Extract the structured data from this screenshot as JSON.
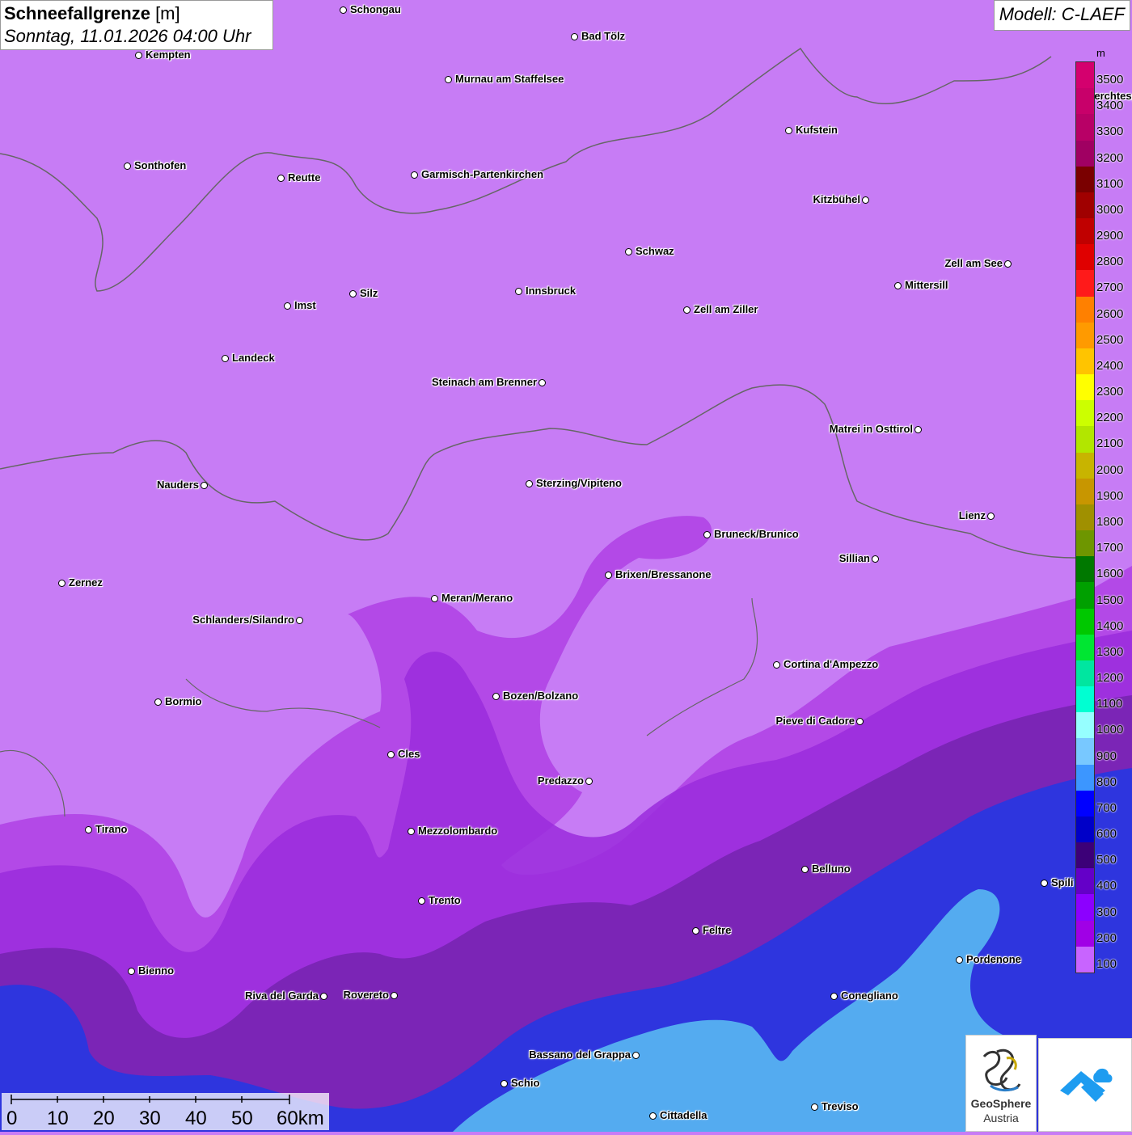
{
  "header": {
    "title_bold": "Schneefallgrenze",
    "title_unit": " [m]",
    "datetime": "Sonntag, 11.01.2026 04:00 Uhr",
    "model": "Modell: C-LAEF"
  },
  "legend": {
    "unit": "m",
    "levels": [
      "3500",
      "3400",
      "3300",
      "3200",
      "3100",
      "3000",
      "2900",
      "2800",
      "2700",
      "2600",
      "2500",
      "2400",
      "2300",
      "2200",
      "2100",
      "2000",
      "1900",
      "1800",
      "1700",
      "1600",
      "1500",
      "1400",
      "1300",
      "1200",
      "1100",
      "1000",
      "900",
      "800",
      "700",
      "600",
      "500",
      "400",
      "300",
      "200",
      "100"
    ],
    "colors": [
      "#d4006e",
      "#c8006a",
      "#b80066",
      "#a00062",
      "#7a0000",
      "#a00000",
      "#c00000",
      "#e00000",
      "#ff1a1a",
      "#ff8000",
      "#ff9a00",
      "#ffc400",
      "#ffff00",
      "#ccff00",
      "#b2e600",
      "#c8b400",
      "#c89600",
      "#a09000",
      "#6e9600",
      "#007800",
      "#00a000",
      "#00c800",
      "#00e632",
      "#00e6a0",
      "#00ffd2",
      "#96ffff",
      "#78c8ff",
      "#3c96ff",
      "#0000ff",
      "#0000c8",
      "#3c0078",
      "#6400c8",
      "#8c00ff",
      "#a000e6",
      "#c864ff"
    ]
  },
  "scale_bar": {
    "ticks": [
      "0",
      "10",
      "20",
      "30",
      "40",
      "50",
      "60km"
    ]
  },
  "logos": {
    "geosphere_line1": "GeoSphere",
    "geosphere_line2": "Austria"
  },
  "cities": [
    {
      "name": "Schongau",
      "label_side": "right"
    },
    {
      "name": "Bad Tölz",
      "label_side": "right"
    },
    {
      "name": "Kempten",
      "label_side": "right"
    },
    {
      "name": "Murnau am Staffelsee",
      "label_side": "right"
    },
    {
      "name": "Berchtesgaden",
      "label_side": "right"
    },
    {
      "name": "Kufstein",
      "label_side": "right"
    },
    {
      "name": "Sonthofen",
      "label_side": "right"
    },
    {
      "name": "Reutte",
      "label_side": "right"
    },
    {
      "name": "Garmisch-Partenkirchen",
      "label_side": "right"
    },
    {
      "name": "Kitzbühel",
      "label_side": "left"
    },
    {
      "name": "Schwaz",
      "label_side": "right"
    },
    {
      "name": "Zell am See",
      "label_side": "left"
    },
    {
      "name": "Innsbruck",
      "label_side": "right"
    },
    {
      "name": "Mittersill",
      "label_side": "right"
    },
    {
      "name": "Silz",
      "label_side": "right"
    },
    {
      "name": "Imst",
      "label_side": "right"
    },
    {
      "name": "Zell am Ziller",
      "label_side": "right"
    },
    {
      "name": "Landeck",
      "label_side": "right"
    },
    {
      "name": "Steinach am Brenner",
      "label_side": "left"
    },
    {
      "name": "Matrei in Osttirol",
      "label_side": "left"
    },
    {
      "name": "Nauders",
      "label_side": "left"
    },
    {
      "name": "Sterzing/Vipiteno",
      "label_side": "right"
    },
    {
      "name": "Lienz",
      "label_side": "left"
    },
    {
      "name": "Bruneck/Brunico",
      "label_side": "right"
    },
    {
      "name": "Sillian",
      "label_side": "left"
    },
    {
      "name": "Brixen/Bressanone",
      "label_side": "right"
    },
    {
      "name": "Zernez",
      "label_side": "right"
    },
    {
      "name": "Meran/Merano",
      "label_side": "right"
    },
    {
      "name": "Schlanders/Silandro",
      "label_side": "left"
    },
    {
      "name": "Cortina d'Ampezzo",
      "label_side": "right"
    },
    {
      "name": "Bozen/Bolzano",
      "label_side": "right"
    },
    {
      "name": "Bormio",
      "label_side": "right"
    },
    {
      "name": "Pieve di Cadore",
      "label_side": "left"
    },
    {
      "name": "Cles",
      "label_side": "right"
    },
    {
      "name": "Predazzo",
      "label_side": "left"
    },
    {
      "name": "Tirano",
      "label_side": "right"
    },
    {
      "name": "Mezzolombardo",
      "label_side": "right"
    },
    {
      "name": "Belluno",
      "label_side": "right"
    },
    {
      "name": "Spili",
      "label_side": "right"
    },
    {
      "name": "Trento",
      "label_side": "right"
    },
    {
      "name": "Feltre",
      "label_side": "right"
    },
    {
      "name": "Pordenone",
      "label_side": "right"
    },
    {
      "name": "Bienno",
      "label_side": "right"
    },
    {
      "name": "Riva del Garda",
      "label_side": "left"
    },
    {
      "name": "Rovereto",
      "label_side": "left"
    },
    {
      "name": "Conegliano",
      "label_side": "right"
    },
    {
      "name": "Bassano del Grappa",
      "label_side": "left"
    },
    {
      "name": "Schio",
      "label_side": "right"
    },
    {
      "name": "Treviso",
      "label_side": "right"
    },
    {
      "name": "Cittadella",
      "label_side": "right"
    }
  ]
}
